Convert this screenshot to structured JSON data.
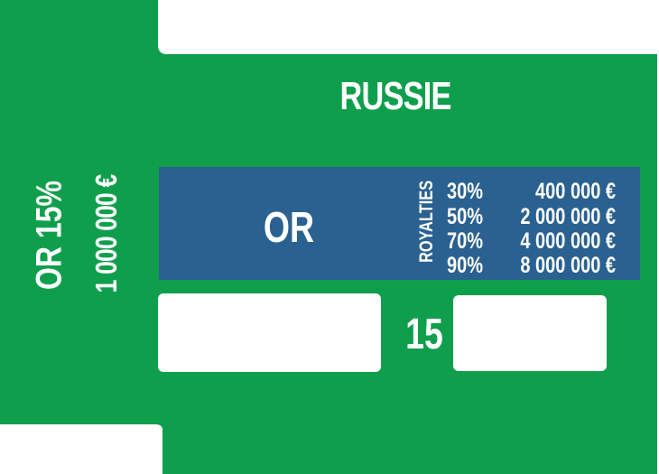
{
  "card": {
    "country": "RUSSIE",
    "resource": "OR",
    "side": {
      "resource_rate": "OR  15%",
      "cost": "1 000 000 €"
    },
    "royalties": {
      "label": "ROYALTIES",
      "rows": [
        {
          "percent": "30%",
          "amount": "400 000 €"
        },
        {
          "percent": "50%",
          "amount": "2 000 000 €"
        },
        {
          "percent": "70%",
          "amount": "4 000 000 €"
        },
        {
          "percent": "90%",
          "amount": "8 000 000 €"
        }
      ]
    },
    "value": "15"
  },
  "colors": {
    "card_green": "#0f9f4c",
    "panel_blue": "#2a6190",
    "text": "#ffffff",
    "box": "#ffffff"
  }
}
